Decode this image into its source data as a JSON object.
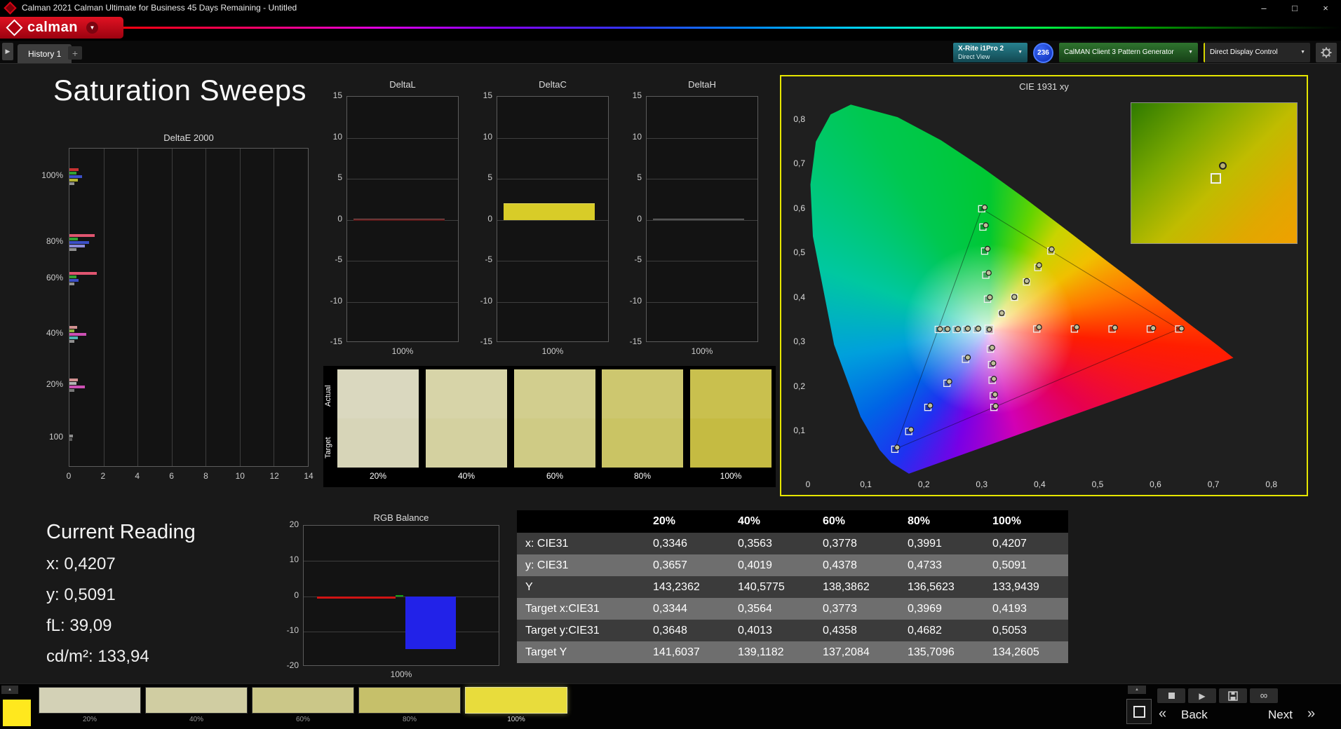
{
  "titlebar": {
    "title": "Calman 2021 Calman Ultimate for Business 45 Days Remaining  - Untitled",
    "minimize": "–",
    "maximize": "□",
    "close": "×"
  },
  "brand": {
    "name": "calman",
    "caret": "▼"
  },
  "toolbar": {
    "nav_arrow": "▶",
    "tab": "History 1",
    "add_tab": "+",
    "meter_line1": "X-Rite i1Pro 2",
    "meter_line2": "Direct View",
    "badge": "236",
    "source": "CalMAN Client 3 Pattern Generator",
    "display_control": "Direct Display Control",
    "caret": "▼"
  },
  "page": {
    "title": "Saturation Sweeps"
  },
  "current_reading": {
    "title": "Current Reading",
    "lines": [
      {
        "label": "x:",
        "value": "0,4207"
      },
      {
        "label": "y:",
        "value": "0,5091"
      },
      {
        "label": "fL:",
        "value": "39,09"
      },
      {
        "label": "cd/m²:",
        "value": "133,94"
      }
    ]
  },
  "swatch_panel": {
    "actual_label": "Actual",
    "target_label": "Target",
    "swatches": [
      {
        "label": "20%",
        "actual": "#dad8bf",
        "target": "#d7d5b8"
      },
      {
        "label": "40%",
        "actual": "#d7d4a8",
        "target": "#d4d1a0"
      },
      {
        "label": "60%",
        "actual": "#d2ce8e",
        "target": "#cfcb85"
      },
      {
        "label": "80%",
        "actual": "#cdc76f",
        "target": "#cac464"
      },
      {
        "label": "100%",
        "actual": "#c9c04e",
        "target": "#c5bb42"
      }
    ]
  },
  "table": {
    "columns": [
      "20%",
      "40%",
      "60%",
      "80%",
      "100%"
    ],
    "rows": [
      {
        "label": "x: CIE31",
        "values": [
          "0,3346",
          "0,3563",
          "0,3778",
          "0,3991",
          "0,4207"
        ]
      },
      {
        "label": "y: CIE31",
        "values": [
          "0,3657",
          "0,4019",
          "0,4378",
          "0,4733",
          "0,5091"
        ]
      },
      {
        "label": "Y",
        "values": [
          "143,2362",
          "140,5775",
          "138,3862",
          "136,5623",
          "133,9439"
        ]
      },
      {
        "label": "Target x:CIE31",
        "values": [
          "0,3344",
          "0,3564",
          "0,3773",
          "0,3969",
          "0,4193"
        ]
      },
      {
        "label": "Target y:CIE31",
        "values": [
          "0,3648",
          "0,4013",
          "0,4358",
          "0,4682",
          "0,5053"
        ]
      },
      {
        "label": "Target Y",
        "values": [
          "141,6037",
          "139,1182",
          "137,2084",
          "135,7096",
          "134,2605"
        ]
      }
    ]
  },
  "bottombar": {
    "patches": [
      {
        "label": "20%",
        "color": "#d3d1b6",
        "selected": false
      },
      {
        "label": "40%",
        "color": "#d0cda2",
        "selected": false
      },
      {
        "label": "60%",
        "color": "#cbc788",
        "selected": false
      },
      {
        "label": "80%",
        "color": "#c6c06a",
        "selected": false
      },
      {
        "label": "100%",
        "color": "#e8dc3c",
        "selected": true
      }
    ],
    "back": "Back",
    "next": "Next",
    "back_chevron": "«",
    "next_chevron": "»",
    "infinity": "∞",
    "play": "▶"
  },
  "chart_data": {
    "deltae2000": {
      "type": "bar",
      "orientation": "horizontal",
      "title": "DeltaE 2000",
      "xlim": [
        0,
        14
      ],
      "x_ticks": [
        0,
        2,
        4,
        6,
        8,
        10,
        12,
        14
      ],
      "groups": [
        {
          "label": "100%",
          "bars": [
            {
              "color": "#c83232",
              "value": 0.55
            },
            {
              "color": "#32a032",
              "value": 0.4
            },
            {
              "color": "#3c50c8",
              "value": 0.75
            },
            {
              "color": "#b4b432",
              "value": 0.5
            },
            {
              "color": "#909090",
              "value": 0.3
            }
          ]
        },
        {
          "label": "80%",
          "bars": [
            {
              "color": "#e05570",
              "value": 1.5
            },
            {
              "color": "#32a032",
              "value": 0.5
            },
            {
              "color": "#3c50c8",
              "value": 1.15
            },
            {
              "color": "#8c8cdc",
              "value": 0.9
            },
            {
              "color": "#909090",
              "value": 0.4
            }
          ]
        },
        {
          "label": "60%",
          "bars": [
            {
              "color": "#e05570",
              "value": 1.6
            },
            {
              "color": "#32a032",
              "value": 0.4
            },
            {
              "color": "#3c50c8",
              "value": 0.55
            },
            {
              "color": "#909090",
              "value": 0.3
            }
          ]
        },
        {
          "label": "40%",
          "bars": [
            {
              "color": "#d09090",
              "value": 0.45
            },
            {
              "color": "#8cb43c",
              "value": 0.3
            },
            {
              "color": "#cc50b4",
              "value": 1.0
            },
            {
              "color": "#50b4b4",
              "value": 0.5
            },
            {
              "color": "#909090",
              "value": 0.3
            }
          ]
        },
        {
          "label": "20%",
          "bars": [
            {
              "color": "#d09090",
              "value": 0.5
            },
            {
              "color": "#b4b4b4",
              "value": 0.4
            },
            {
              "color": "#cc50b4",
              "value": 0.9
            },
            {
              "color": "#787878",
              "value": 0.3
            }
          ]
        },
        {
          "label": "100",
          "bars": [
            {
              "color": "#8c8c8c",
              "value": 0.2
            },
            {
              "color": "#5a5a5a",
              "value": 0.15
            }
          ]
        }
      ]
    },
    "delta_l": {
      "type": "bar",
      "title": "DeltaL",
      "ylim": [
        -15,
        15
      ],
      "y_ticks": [
        15,
        10,
        5,
        0,
        -5,
        -10,
        -15
      ],
      "x_label": "100%",
      "value": 0.15,
      "color": "#5c1a1a"
    },
    "delta_c": {
      "type": "bar",
      "title": "DeltaC",
      "ylim": [
        -15,
        15
      ],
      "y_ticks": [
        15,
        10,
        5,
        0,
        -5,
        -10,
        -15
      ],
      "x_label": "100%",
      "value": 2.0,
      "color": "#d8cc28"
    },
    "delta_h": {
      "type": "bar",
      "title": "DeltaH",
      "ylim": [
        -15,
        15
      ],
      "y_ticks": [
        15,
        10,
        5,
        0,
        -5,
        -10,
        -15
      ],
      "x_label": "100%",
      "value": 0.12,
      "color": "#404040"
    },
    "rgb_balance": {
      "type": "bar",
      "title": "RGB Balance",
      "ylim": [
        -20,
        20
      ],
      "y_ticks": [
        20,
        10,
        0,
        -10,
        -20
      ],
      "x_label": "100%",
      "series": [
        {
          "name": "Red",
          "value": -0.6,
          "color": "#d01414"
        },
        {
          "name": "Green",
          "value": 0.2,
          "color": "#14a014"
        },
        {
          "name": "Blue",
          "value": -15.0,
          "color": "#2222e8"
        }
      ]
    },
    "cie_1931": {
      "type": "scatter",
      "title": "CIE 1931 xy",
      "x_ticks": [
        "0",
        "0,1",
        "0,2",
        "0,3",
        "0,4",
        "0,5",
        "0,6",
        "0,7",
        "0,8"
      ],
      "y_ticks": [
        "0,1",
        "0,2",
        "0,3",
        "0,4",
        "0,5",
        "0,6",
        "0,7",
        "0,8"
      ],
      "axis_max": 0.85,
      "white_point": [
        0.313,
        0.329
      ],
      "srgb_triangle": [
        [
          0.64,
          0.33
        ],
        [
          0.3,
          0.6
        ],
        [
          0.15,
          0.06
        ]
      ],
      "sweeps": [
        {
          "name": "red",
          "targets": [
            [
              0.395,
              0.33
            ],
            [
              0.46,
              0.33
            ],
            [
              0.525,
              0.33
            ],
            [
              0.591,
              0.33
            ],
            [
              0.64,
              0.33
            ]
          ],
          "measured": [
            [
              0.399,
              0.334
            ],
            [
              0.464,
              0.334
            ],
            [
              0.53,
              0.333
            ],
            [
              0.596,
              0.332
            ],
            [
              0.645,
              0.331
            ]
          ]
        },
        {
          "name": "green",
          "targets": [
            [
              0.31,
              0.397
            ],
            [
              0.307,
              0.451
            ],
            [
              0.305,
              0.505
            ],
            [
              0.302,
              0.559
            ],
            [
              0.3,
              0.6
            ]
          ],
          "measured": [
            [
              0.314,
              0.401
            ],
            [
              0.312,
              0.456
            ],
            [
              0.31,
              0.51
            ],
            [
              0.307,
              0.563
            ],
            [
              0.305,
              0.603
            ]
          ]
        },
        {
          "name": "blue",
          "targets": [
            [
              0.272,
              0.262
            ],
            [
              0.24,
              0.208
            ],
            [
              0.207,
              0.154
            ],
            [
              0.174,
              0.1
            ],
            [
              0.15,
              0.06
            ]
          ],
          "measured": [
            [
              0.276,
              0.266
            ],
            [
              0.244,
              0.212
            ],
            [
              0.211,
              0.158
            ],
            [
              0.178,
              0.104
            ],
            [
              0.154,
              0.064
            ]
          ]
        },
        {
          "name": "yellow",
          "targets": [
            [
              0.3344,
              0.3648
            ],
            [
              0.3564,
              0.4013
            ],
            [
              0.3773,
              0.4358
            ],
            [
              0.3969,
              0.4682
            ],
            [
              0.4193,
              0.5053
            ]
          ],
          "measured": [
            [
              0.3346,
              0.3657
            ],
            [
              0.3563,
              0.4019
            ],
            [
              0.3778,
              0.4378
            ],
            [
              0.3991,
              0.4733
            ],
            [
              0.4207,
              0.5091
            ]
          ]
        },
        {
          "name": "cyan",
          "targets": [
            [
              0.291,
              0.329
            ],
            [
              0.273,
              0.329
            ],
            [
              0.256,
              0.329
            ],
            [
              0.238,
              0.329
            ],
            [
              0.225,
              0.329
            ]
          ],
          "measured": [
            [
              0.294,
              0.331
            ],
            [
              0.276,
              0.331
            ],
            [
              0.259,
              0.33
            ],
            [
              0.241,
              0.33
            ],
            [
              0.228,
              0.33
            ]
          ]
        },
        {
          "name": "magenta",
          "targets": [
            [
              0.315,
              0.285
            ],
            [
              0.317,
              0.25
            ],
            [
              0.318,
              0.215
            ],
            [
              0.32,
              0.18
            ],
            [
              0.321,
              0.154
            ]
          ],
          "measured": [
            [
              0.318,
              0.288
            ],
            [
              0.32,
              0.253
            ],
            [
              0.321,
              0.218
            ],
            [
              0.323,
              0.183
            ],
            [
              0.324,
              0.157
            ]
          ]
        }
      ]
    }
  }
}
